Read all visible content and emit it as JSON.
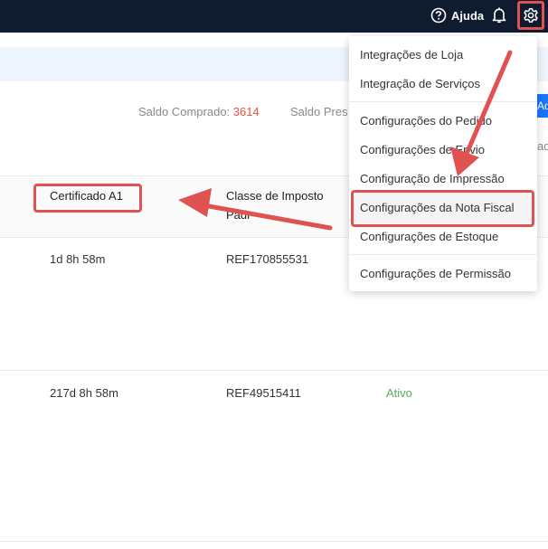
{
  "header": {
    "help_label": "Ajuda",
    "icons": [
      "question-circle-icon",
      "bell-icon",
      "gear-icon"
    ],
    "background": "#0f1b2e"
  },
  "summary": {
    "saldo_comprado_label": "Saldo Comprado:",
    "saldo_comprado_value": "3614",
    "saldo_pres_label": "Saldo Pres",
    "button_fragment": "Adi",
    "right_fragment": "ad"
  },
  "table": {
    "headers": [
      "Certificado A1",
      "Classe de Imposto",
      "Padr"
    ],
    "rows": [
      {
        "cert": "1d 8h 58m",
        "ref": "REF170855531",
        "status": ""
      },
      {
        "cert": "217d 8h 58m",
        "ref": "REF49515411",
        "status": "Ativo"
      }
    ]
  },
  "menu": {
    "items": [
      "Integrações de Loja",
      "Integração de Serviços",
      "Configurações do Pedido",
      "Configurações de Envio",
      "Configuração de Impressão",
      "Configurações da Nota Fiscal",
      "Configurações de Estoque",
      "Configurações de Permissão"
    ]
  },
  "colors": {
    "annotation": "#e05252",
    "accent": "#1677ff",
    "active_status": "#52b05a",
    "number_highlight": "#e8543f"
  }
}
